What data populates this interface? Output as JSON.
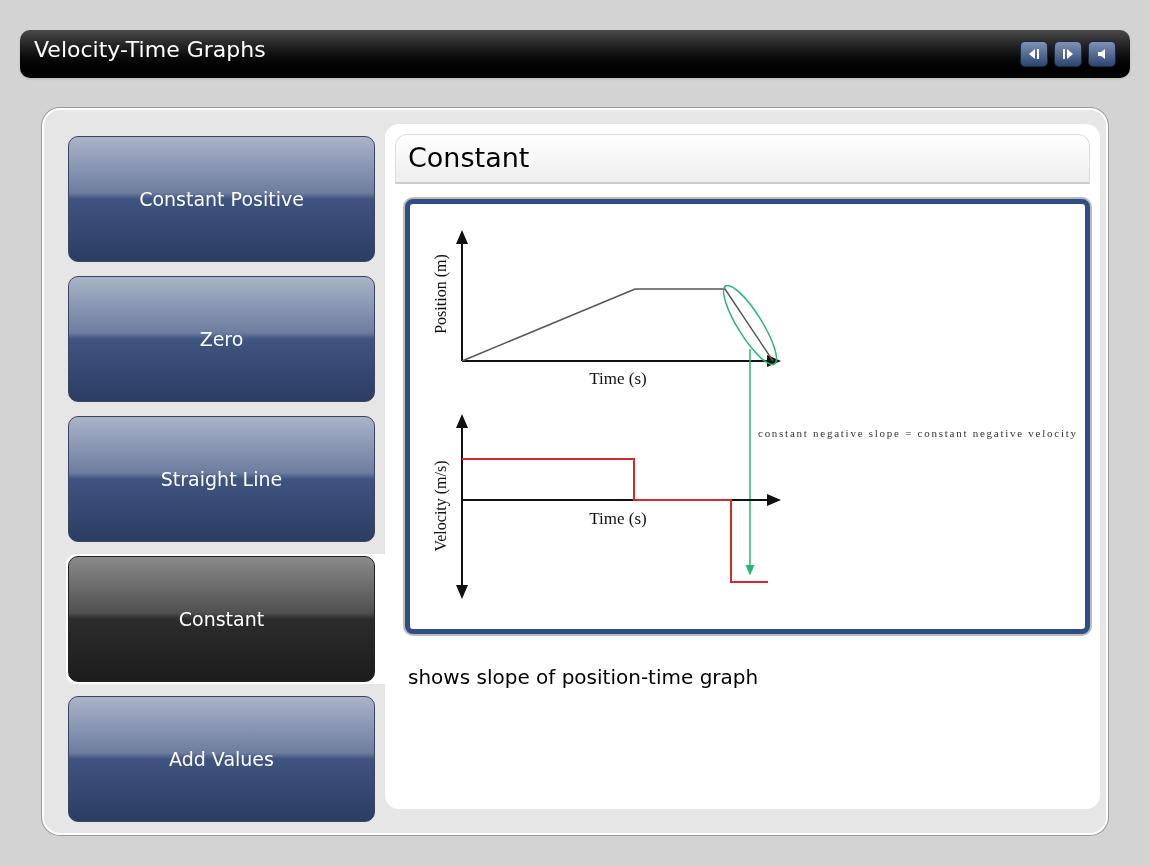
{
  "header": {
    "title": "Velocity-Time Graphs"
  },
  "menu": [
    {
      "label": "Constant Positive",
      "selected": false
    },
    {
      "label": "Zero",
      "selected": false
    },
    {
      "label": "Straight Line",
      "selected": false
    },
    {
      "label": "Constant",
      "selected": true
    },
    {
      "label": "Add Values",
      "selected": false
    }
  ],
  "content": {
    "title": "Constant",
    "figure": {
      "position_axis": "Position (m)",
      "time_axis_top": "Time (s)",
      "velocity_axis": "Velocity (m/s)",
      "time_axis_bottom": "Time (s)",
      "annotation": "constant negative slope  = constant negative velocity"
    },
    "description": "shows slope of position-time graph"
  }
}
